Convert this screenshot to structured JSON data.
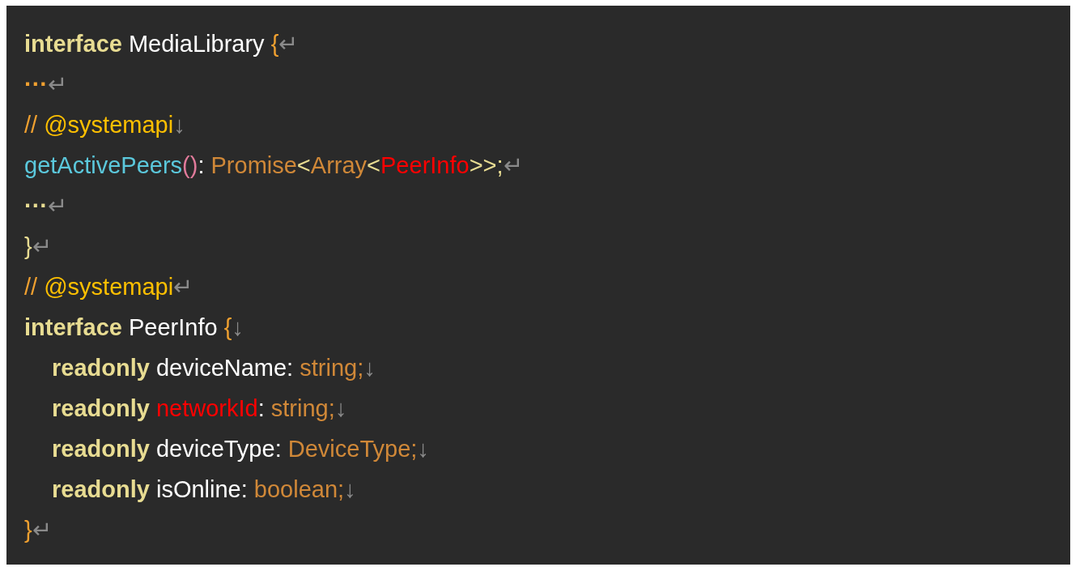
{
  "code_block": {
    "lines": [
      {
        "tokens": [
          {
            "text": "interface",
            "color": "#e8dc92",
            "bold": true
          },
          {
            "text": " MediaLibrary ",
            "color": "#ffffff"
          },
          {
            "text": "{",
            "color": "#f0a030"
          },
          {
            "text": "↵",
            "color": "#8a8a8a"
          }
        ]
      },
      {
        "tokens": [
          {
            "text": "···",
            "color": "#f0a030",
            "bold": true
          },
          {
            "text": "↵",
            "color": "#8a8a8a"
          }
        ]
      },
      {
        "tokens": [
          {
            "text": "// ",
            "color": "#f0a030"
          },
          {
            "text": "@systemapi",
            "color": "#ffc000"
          },
          {
            "text": "↓",
            "color": "#8a8a8a"
          }
        ]
      },
      {
        "tokens": [
          {
            "text": "getActivePeers",
            "color": "#5bc8dc"
          },
          {
            "text": "()",
            "color": "#e07a9a"
          },
          {
            "text": ": ",
            "color": "#ffffff"
          },
          {
            "text": "Promise",
            "color": "#d08838"
          },
          {
            "text": "<",
            "color": "#e8dc92"
          },
          {
            "text": "Array",
            "color": "#d08838"
          },
          {
            "text": "<",
            "color": "#e8dc92"
          },
          {
            "text": "PeerInfo",
            "color": "#ff0000"
          },
          {
            "text": ">>;",
            "color": "#e8dc92"
          },
          {
            "text": "↵",
            "color": "#8a8a8a"
          }
        ]
      },
      {
        "tokens": [
          {
            "text": "···",
            "color": "#e8dc92",
            "bold": true
          },
          {
            "text": "↵",
            "color": "#8a8a8a"
          }
        ]
      },
      {
        "tokens": [
          {
            "text": "}",
            "color": "#e8dc92"
          },
          {
            "text": "↵",
            "color": "#8a8a8a"
          }
        ]
      },
      {
        "tokens": [
          {
            "text": "// ",
            "color": "#f0a030"
          },
          {
            "text": "@systemapi",
            "color": "#ffc000"
          },
          {
            "text": "↵",
            "color": "#8a8a8a"
          }
        ]
      },
      {
        "tokens": [
          {
            "text": "interface",
            "color": "#e8dc92",
            "bold": true
          },
          {
            "text": " PeerInfo ",
            "color": "#ffffff"
          },
          {
            "text": "{",
            "color": "#f0a030"
          },
          {
            "text": "↓",
            "color": "#8a8a8a"
          }
        ],
        "children": [
          {
            "tokens": [
              {
                "text": "readonly",
                "color": "#e8dc92",
                "bold": true
              },
              {
                "text": " deviceName: ",
                "color": "#ffffff"
              },
              {
                "text": "string;",
                "color": "#d08838"
              },
              {
                "text": "↓",
                "color": "#8a8a8a"
              }
            ]
          },
          {
            "tokens": [
              {
                "text": "readonly",
                "color": "#e8dc92",
                "bold": true
              },
              {
                "text": " networkId",
                "color": "#ff0000"
              },
              {
                "text": ": ",
                "color": "#ffffff"
              },
              {
                "text": "string;",
                "color": "#d08838"
              },
              {
                "text": "↓",
                "color": "#8a8a8a"
              }
            ]
          },
          {
            "tokens": [
              {
                "text": "readonly",
                "color": "#e8dc92",
                "bold": true
              },
              {
                "text": " deviceType: ",
                "color": "#ffffff"
              },
              {
                "text": "DeviceType;",
                "color": "#d08838"
              },
              {
                "text": "↓",
                "color": "#8a8a8a"
              }
            ]
          },
          {
            "tokens": [
              {
                "text": "readonly",
                "color": "#e8dc92",
                "bold": true
              },
              {
                "text": " isOnline: ",
                "color": "#ffffff"
              },
              {
                "text": "boolean;",
                "color": "#d08838"
              },
              {
                "text": "↓",
                "color": "#8a8a8a"
              }
            ]
          }
        ]
      },
      {
        "tokens": [
          {
            "text": "}",
            "color": "#f0a030"
          },
          {
            "text": "↵",
            "color": "#8a8a8a"
          }
        ]
      }
    ]
  }
}
